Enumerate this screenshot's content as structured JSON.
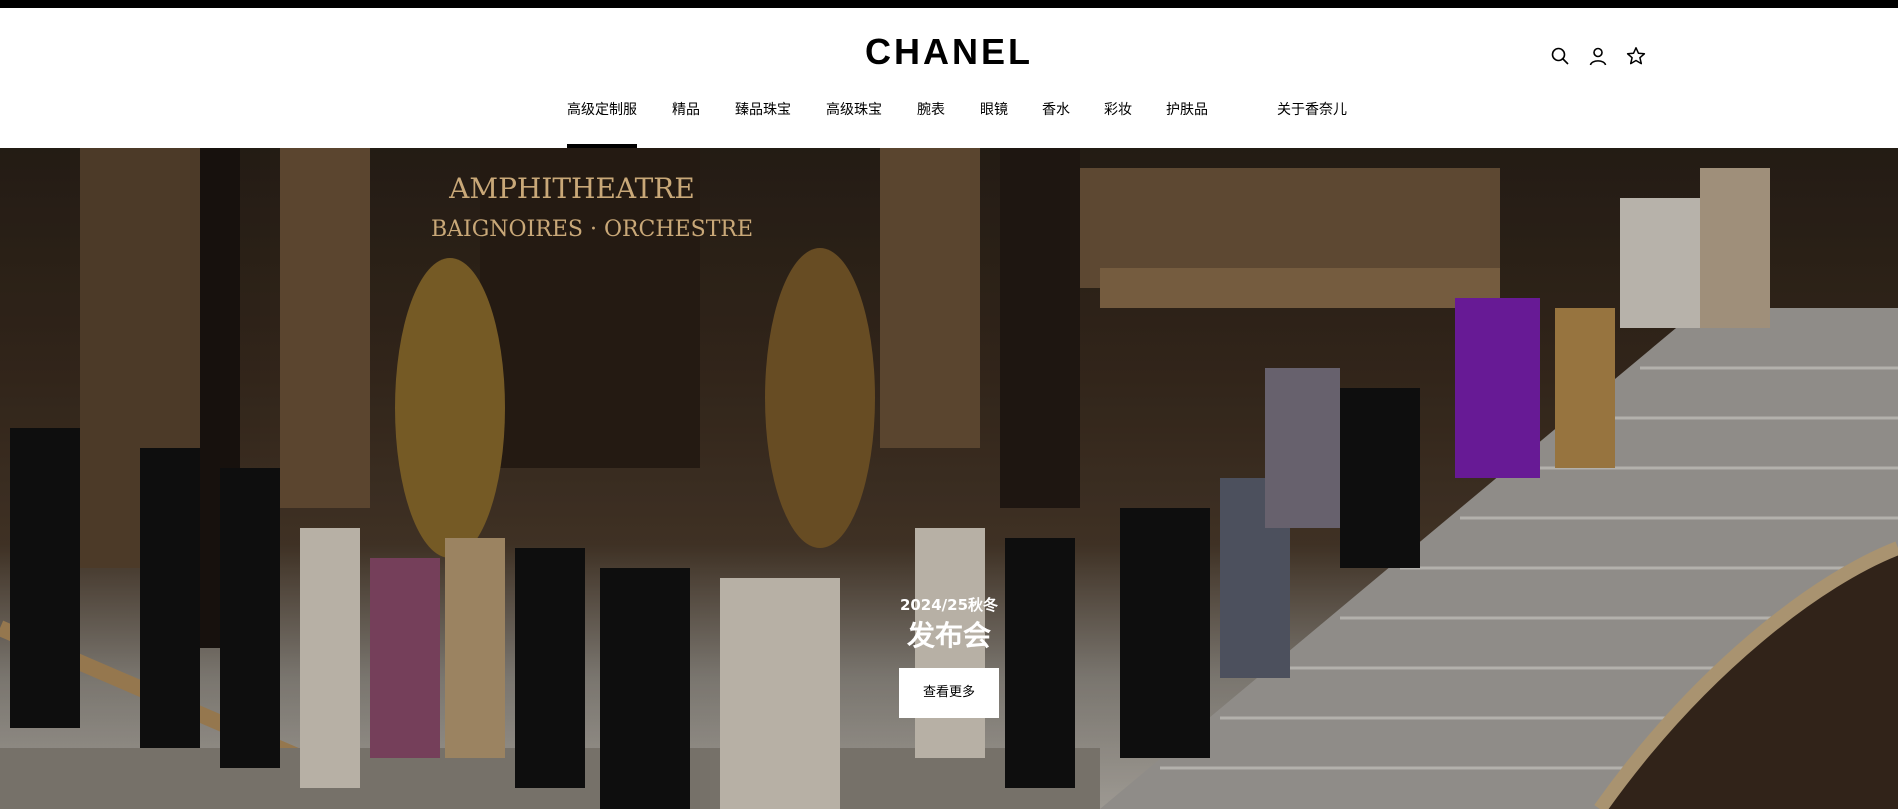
{
  "brand": {
    "logo_text": "CHANEL"
  },
  "header": {
    "icons": [
      "search-icon",
      "account-icon",
      "wishlist-star-icon"
    ]
  },
  "nav": {
    "items": [
      {
        "label": "高级定制服",
        "active": true
      },
      {
        "label": "精品"
      },
      {
        "label": "臻品珠宝"
      },
      {
        "label": "高级珠宝"
      },
      {
        "label": "腕表"
      },
      {
        "label": "眼镜"
      },
      {
        "label": "香水"
      },
      {
        "label": "彩妆"
      },
      {
        "label": "护肤品"
      },
      {
        "label": "关于香奈儿"
      }
    ]
  },
  "hero": {
    "background_text_line1": "AMPHITHEATRE",
    "background_text_line2": "BAIGNOIRES · ORCHESTRE",
    "subtitle": "2024/25秋冬",
    "title": "发布会",
    "cta_label": "查看更多"
  },
  "colors": {
    "text": "#000000",
    "background": "#ffffff",
    "hero_text": "#ffffff"
  }
}
